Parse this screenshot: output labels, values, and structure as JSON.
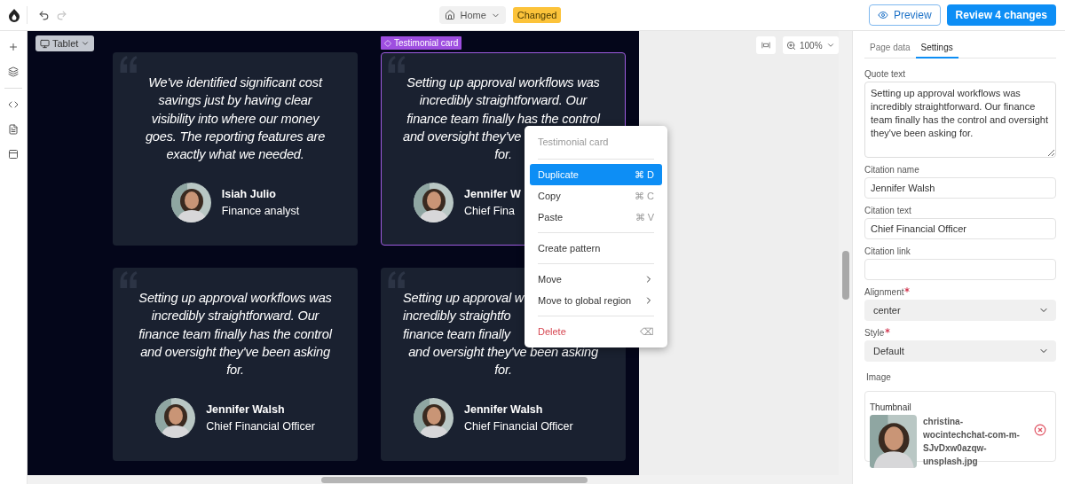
{
  "toolbar": {
    "page": "Home",
    "status": "Changed",
    "preview": "Preview",
    "review": "Review 4 changes"
  },
  "rail": [
    {
      "kind": "add"
    },
    {
      "kind": "layers"
    },
    {
      "kind": "code"
    },
    {
      "kind": "page"
    },
    {
      "kind": "template"
    }
  ],
  "canvas": {
    "device": "Tablet",
    "selection_label": "Testimonial card",
    "zoom": "100%",
    "cards": [
      {
        "kind": "whole",
        "selected": false,
        "name": "Isiah Julio",
        "role": "Finance analyst",
        "quote_lines": [
          {
            "kind": "full",
            "text": "We've identified significant cost"
          },
          {
            "kind": "full",
            "text": "savings just by having clear"
          },
          {
            "kind": "full",
            "text": "visibility into where our money"
          },
          {
            "kind": "full",
            "text": "goes. The reporting features are"
          },
          {
            "kind": "full",
            "text": "exactly what we needed."
          }
        ]
      },
      {
        "kind": "covered",
        "selected": true,
        "name": "Jennifer W",
        "role": "Chief Fina",
        "quote_lines": [
          {
            "kind": "full",
            "text": "Setting up approval workflows was"
          },
          {
            "kind": "full",
            "text": "incredibly straightforward. Our"
          },
          {
            "kind": "full",
            "text": "finance team finally has the control"
          },
          {
            "kind": "clipped",
            "text": "and oversight they've"
          },
          {
            "kind": "full",
            "text": "for."
          }
        ]
      },
      {
        "kind": "whole",
        "selected": false,
        "name": "Jennifer Walsh",
        "role": "Chief Financial Officer",
        "quote_lines": [
          {
            "kind": "full",
            "text": "Setting up approval workflows was"
          },
          {
            "kind": "full",
            "text": "incredibly straightforward. Our"
          },
          {
            "kind": "full",
            "text": "finance team finally has the control"
          },
          {
            "kind": "full",
            "text": "and oversight they've been asking"
          },
          {
            "kind": "full",
            "text": "for."
          }
        ]
      },
      {
        "kind": "covered",
        "selected": false,
        "name": "Jennifer Walsh",
        "role": "Chief Financial Officer",
        "quote_lines": [
          {
            "kind": "clipped",
            "text": "Setting up approval w"
          },
          {
            "kind": "clipped",
            "text": "incredibly straightfo"
          },
          {
            "kind": "clipped",
            "text": "finance team finally"
          },
          {
            "kind": "full",
            "text": "and oversight they've been asking"
          },
          {
            "kind": "full",
            "text": "for."
          }
        ]
      }
    ]
  },
  "context_menu": {
    "title": "Testimonial card",
    "groups": [
      [
        {
          "kind": "action",
          "label": "Duplicate",
          "shortcut": "⌘ D",
          "selected": true
        },
        {
          "kind": "action",
          "label": "Copy",
          "shortcut": "⌘ C",
          "selected": false
        },
        {
          "kind": "action",
          "label": "Paste",
          "shortcut": "⌘ V",
          "selected": false
        }
      ],
      [
        {
          "kind": "action",
          "label": "Create pattern",
          "selected": false
        }
      ],
      [
        {
          "kind": "submenu",
          "label": "Move",
          "selected": false
        },
        {
          "kind": "submenu",
          "label": "Move to global region",
          "selected": false
        }
      ],
      [
        {
          "kind": "danger",
          "label": "Delete",
          "shortcut": "⌫",
          "selected": false
        }
      ]
    ]
  },
  "panel": {
    "tabs": [
      {
        "label": "Page data",
        "selected": false
      },
      {
        "label": "Settings",
        "selected": true
      }
    ],
    "fields": [
      {
        "kind": "textarea",
        "label": "Quote text",
        "value": "Setting up approval workflows was incredibly straightforward. Our finance team finally has the control and oversight they've been asking for.",
        "required": false
      },
      {
        "kind": "text",
        "label": "Citation name",
        "value": "Jennifer Walsh",
        "required": false
      },
      {
        "kind": "text",
        "label": "Citation text",
        "value": "Chief Financial Officer",
        "required": false
      },
      {
        "kind": "text",
        "label": "Citation link",
        "required": false
      },
      {
        "kind": "select",
        "label": "Alignment",
        "value": "center",
        "required": true
      },
      {
        "kind": "select",
        "label": "Style",
        "value": "Default",
        "required": true
      }
    ],
    "image": {
      "label": "Image",
      "thumbnail_label": "Thumbnail",
      "filename": "christina-wocintechchat-com-m-SJvDxw0azqw-unsplash.jpg"
    }
  }
}
